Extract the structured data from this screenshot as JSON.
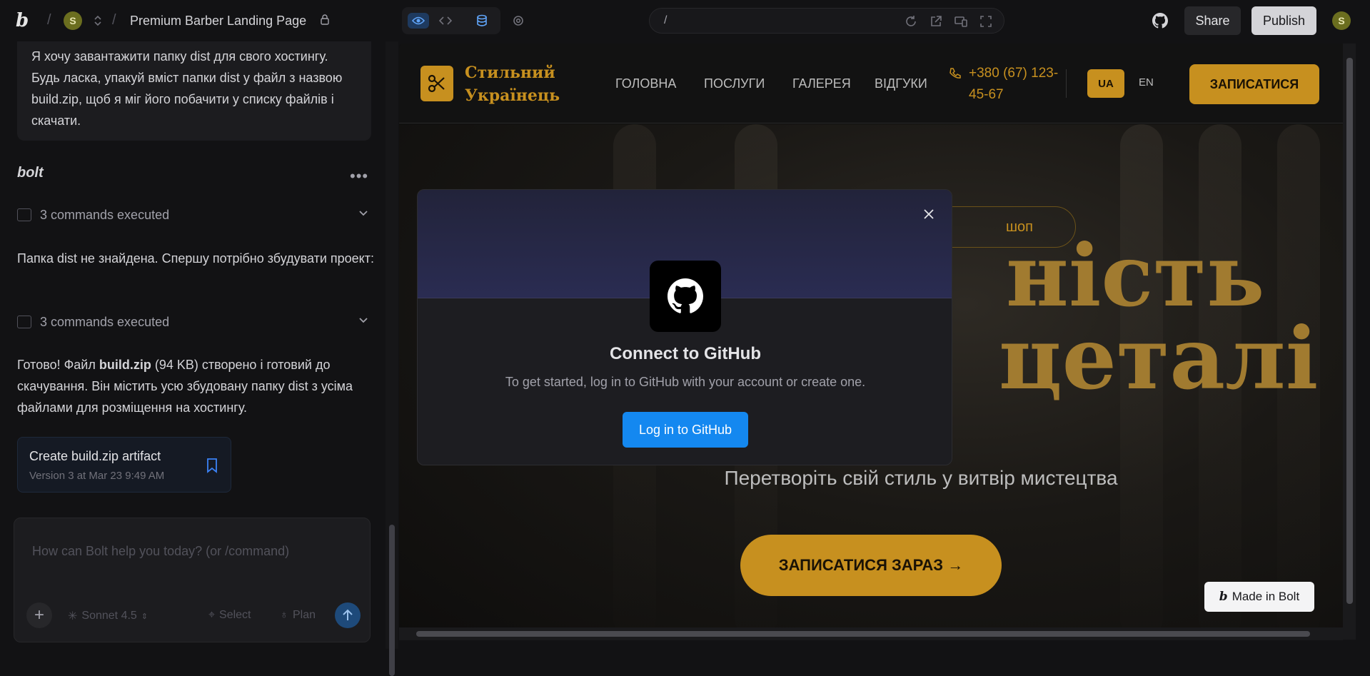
{
  "topbar": {
    "logo": "b",
    "avatar_initial": "S",
    "project_title": "Premium Barber Landing Page",
    "url": "/",
    "share_label": "Share",
    "publish_label": "Publish",
    "user_initial": "S",
    "icons": [
      "eye-icon",
      "code-icon",
      "database-icon",
      "gear-icon",
      "refresh-icon",
      "external-link-icon",
      "device-icon",
      "fullscreen-icon",
      "github-icon"
    ]
  },
  "chat": {
    "user_message": "Я хочу завантажити папку dist для свого хостингу. Будь ласка, упакуй вміст папки dist у файл з назвою build.zip, щоб я міг його побачити у списку файлів і скачати.",
    "assistant_name": "bolt",
    "commands_1": "3 commands executed",
    "message_1": "Папка dist не знайдена. Спершу потрібно збудувати проект:",
    "commands_2": "3 commands executed",
    "message_2_prefix": "Готово! Файл ",
    "message_2_bold": "build.zip",
    "message_2_suffix": " (94 KB) створено і готовий до скачування. Він містить усю збудовану папку dist з усіма файлами для розміщення на хостингу.",
    "artifact": {
      "title": "Create build.zip artifact",
      "subtitle": "Version 3 at Mar 23 9:49 AM"
    },
    "input": {
      "placeholder": "How can Bolt help you today? (or /command)",
      "model": "Sonnet 4.5",
      "select_label": "Select",
      "plan_label": "Plan"
    }
  },
  "site": {
    "name_line1": "Стильний",
    "name_line2": "Українець",
    "nav": [
      "ГОЛОВНА",
      "ПОСЛУГИ",
      "ГАЛЕРЕЯ",
      "ВІДГУКИ"
    ],
    "phone_line1": "+380 (67) 123-",
    "phone_line2": "45-67",
    "lang_ua": "UA",
    "lang_en": "EN",
    "book_label": "ЗАПИСАТИСЯ",
    "hero_pill": "шоп",
    "hero_title_line1": "ність",
    "hero_title_line2": "цеталі",
    "hero_subtitle": "Перетворіть свій стиль у витвір мистецтва",
    "hero_cta": "ЗАПИСАТИСЯ ЗАРАЗ →",
    "made_in_bolt": "Made in Bolt"
  },
  "modal": {
    "title": "Connect to GitHub",
    "description": "To get started, log in to GitHub with your account or create one.",
    "button_label": "Log in to GitHub"
  },
  "colors": {
    "accent_gold": "#c7901f",
    "github_blue": "#1488f0"
  }
}
